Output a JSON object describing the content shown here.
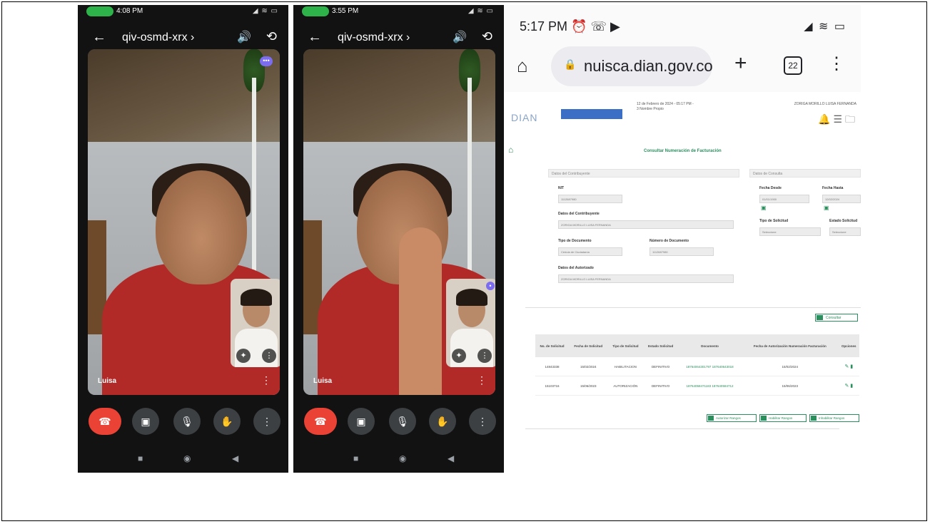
{
  "phone1": {
    "time": "4:08 PM",
    "status_icons": "◢ ≋ ▭",
    "meeting_code": "qiv-osmd-xrx ›",
    "participant_name": "Luisa"
  },
  "phone2": {
    "time": "3:55 PM",
    "status_icons": "◢ ≋ ▭",
    "meeting_code": "qiv-osmd-xrx ›",
    "participant_name": "Luisa"
  },
  "browser": {
    "time": "5:17 PM ⏰ ☏ ▶",
    "status_icons": "◢ ≋ ▭",
    "url": "nuisca.dian.gov.co",
    "tab_count": "22",
    "page": {
      "logo": "DIAN",
      "header_date": "12 de Febrero de 2024 - 05:17 PM - 3 Nombre Propio",
      "user_name": "ZORIGA MORILLO LUISA FERNANDA",
      "title": "Consultar Numeración de Facturación",
      "section_contrib": "Datos del Contribuyente",
      "section_search": "Datos de Consulta",
      "nit_label": "NIT",
      "nit_value": "1112687980",
      "razon_label": "Datos del Contribuyente",
      "razon_value": "ZORIGA MORILLO LUISA FERNANDA",
      "tipo_doc_label": "Tipo de Documento",
      "tipo_doc_value": "Cédula de Ciudadanía",
      "num_doc_label": "Número de Documento",
      "num_doc_value": "1112687980",
      "autorizado_label": "Datos del Autorizado",
      "autorizado_value": "ZORIGA MORILLO LUISA FERNANDA",
      "fecha_desde_label": "Fecha Desde",
      "fecha_desde_value": "01/01/1900",
      "fecha_hasta_label": "Fecha Hasta",
      "fecha_hasta_value": "12/02/2024",
      "tipo_sol_label": "Tipo de Solicitud",
      "tipo_sol_value": "Seleccione",
      "estado_sol_label": "Estado Solicitud",
      "estado_sol_value": "Seleccione",
      "consultar_label": "Consultar",
      "table_headers": [
        "No. de Solicitud",
        "Fecha de Solicitud",
        "Tipo de Solicitud",
        "Estado Solicitud",
        "Documento",
        "Fecha de Autorización Numeración Facturación",
        "Opciones"
      ],
      "rows": [
        [
          "14843338",
          "15/02/2024",
          "HABILITACION",
          "DEFINITIVO",
          "18764064301797 187640643018",
          "15/02/2024",
          "✎ ▮"
        ],
        [
          "15103716",
          "15/06/2023",
          "AUTORIZACIÓN",
          "DEFINITIVO",
          "18764058471183 187640584712",
          "15/06/2023",
          "✎ ▮"
        ]
      ],
      "action_1": "Autorizar Rangos",
      "action_2": "Habilitar Rangos",
      "action_3": "Inhabilitar Rangos"
    }
  }
}
